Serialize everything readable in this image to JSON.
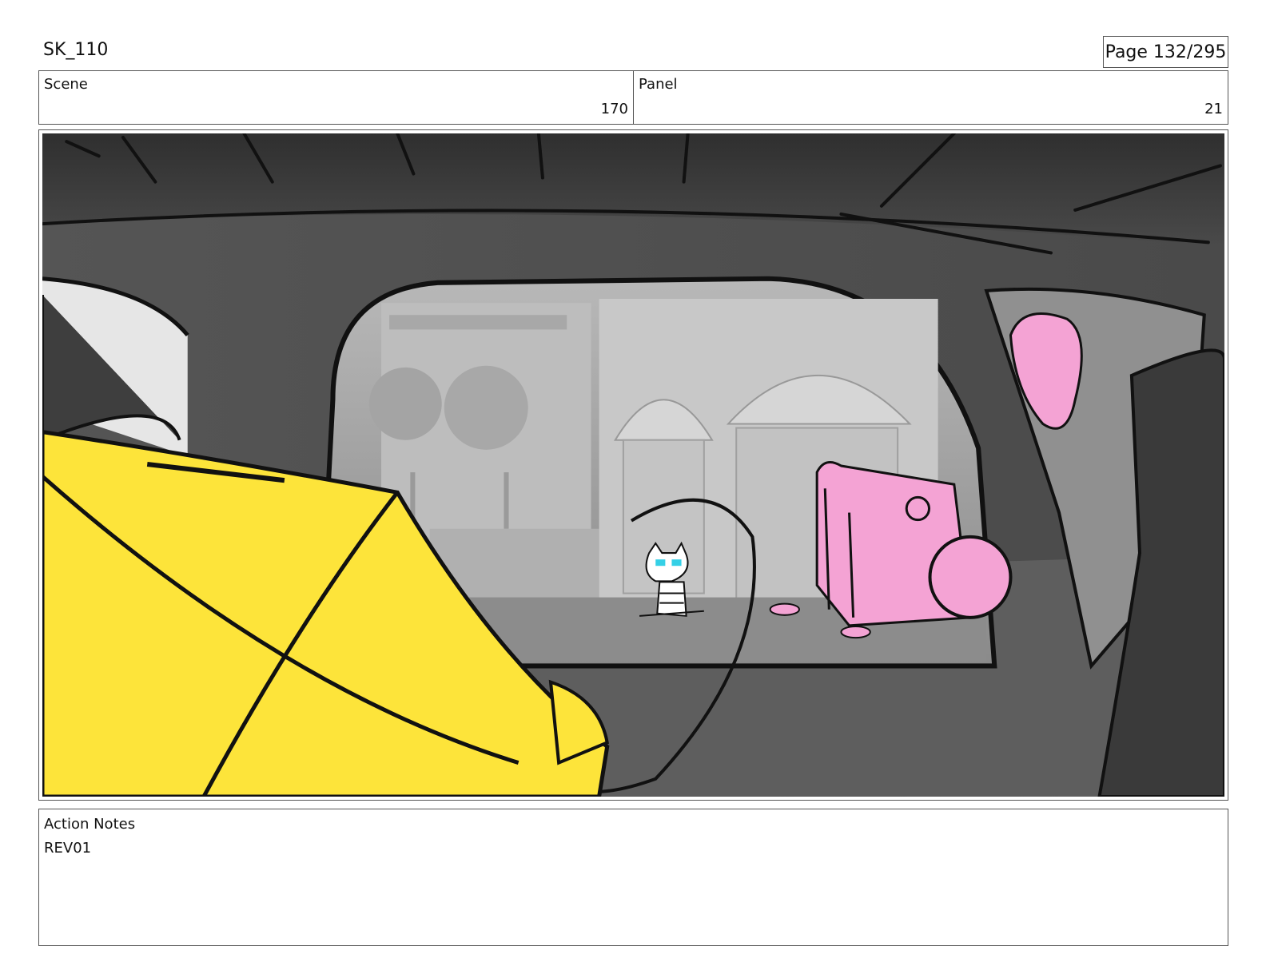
{
  "header": {
    "sequence": "SK_110",
    "page": "Page 132/295"
  },
  "info": {
    "scene_label": "Scene",
    "scene_value": "170",
    "panel_label": "Panel",
    "panel_value": "21"
  },
  "notes": {
    "label": "Action Notes",
    "text": "REV01"
  },
  "colors": {
    "umbrella_yellow": "#fde43a",
    "pink_prop": "#f4a3d4",
    "cat_eyes": "#35d0e6",
    "interior_dark": "#3c3c3c",
    "window_gray": "#8e8e8e"
  }
}
